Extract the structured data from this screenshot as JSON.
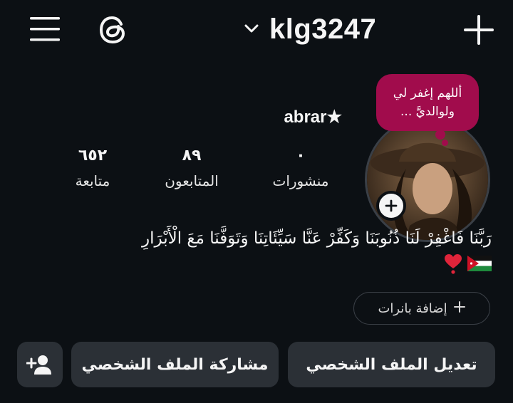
{
  "header": {
    "username": "klg3247"
  },
  "note": {
    "text": "أللهم إغفر لي ولوالديَّ ..."
  },
  "profile": {
    "display_name": "abrar★",
    "stats": [
      {
        "key": "posts",
        "value": "٠",
        "label": "منشورات"
      },
      {
        "key": "followers",
        "value": "٨٩",
        "label": "المتابعون"
      },
      {
        "key": "following",
        "value": "٦٥٢",
        "label": "متابعة"
      }
    ],
    "bio": "رَبَّنَا فَاغْفِرْ لَنَا ذُنُوبَنَا وَكَفِّرْ عَنَّا سَيِّئَاتِنَا وَتَوَفَّنَا مَعَ الْأَبْرَارِ"
  },
  "buttons": {
    "add_banners": "إضافة بانرات",
    "edit_profile": "تعديل الملف الشخصي",
    "share_profile": "مشاركة الملف الشخصي"
  },
  "colors": {
    "background": "#0c1014",
    "note_bubble": "#a10c4c",
    "button_bg": "#2b3036"
  }
}
